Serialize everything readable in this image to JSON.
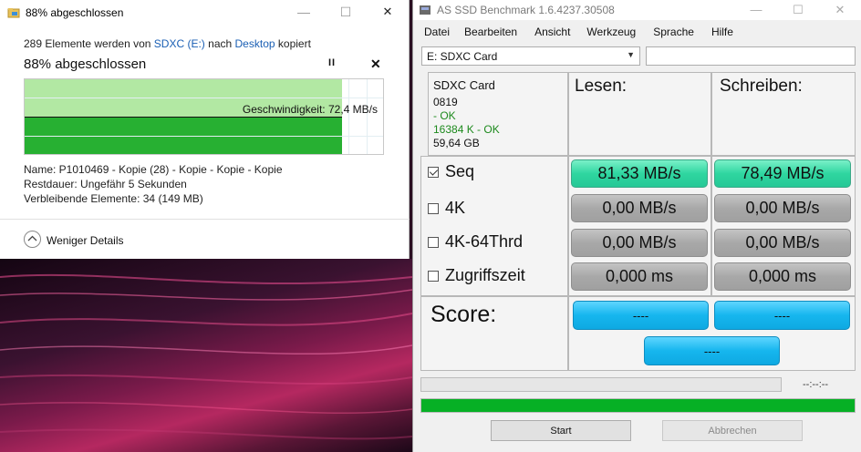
{
  "copy_dialog": {
    "title": "88% abgeschlossen",
    "summary_prefix": "289 Elemente werden von",
    "source": "SDXC (E:)",
    "summary_middle": "nach",
    "destination": "Desktop",
    "summary_suffix": "kopiert",
    "percent_text": "88% abgeschlossen",
    "progress_fraction": 0.88,
    "speed_label": "Geschwindigkeit: 72,4 MB/s",
    "name_line": "Name:  P1010469 - Kopie (28) - Kopie - Kopie - Kopie",
    "remaining_line": "Restdauer:  Ungefähr 5 Sekunden",
    "items_line": "Verbleibende Elemente:  34 (149 MB)",
    "details_label": "Weniger Details",
    "pause_symbol": "II",
    "cancel_symbol": "✕",
    "minimize_symbol": "—",
    "maximize_symbol": "☐",
    "close_symbol": "✕"
  },
  "ssd": {
    "title": "AS SSD Benchmark 1.6.4237.30508",
    "menu": [
      "Datei",
      "Bearbeiten",
      "Ansicht",
      "Werkzeug",
      "Sprache",
      "Hilfe"
    ],
    "drive_selected": "E: SDXC Card",
    "drive": {
      "name": "SDXC Card",
      "id": "0819",
      "status1": " - OK",
      "status2": "16384 K - OK",
      "size": "59,64 GB"
    },
    "col_read": "Lesen:",
    "col_write": "Schreiben:",
    "rows": [
      {
        "label": "Seq",
        "checked": true,
        "read": "81,33 MB/s",
        "write": "78,49 MB/s"
      },
      {
        "label": "4K",
        "checked": false,
        "read": "0,00 MB/s",
        "write": "0,00 MB/s"
      },
      {
        "label": "4K-64Thrd",
        "checked": false,
        "read": "0,00 MB/s",
        "write": "0,00 MB/s"
      },
      {
        "label": "Zugriffszeit",
        "checked": false,
        "read": "0,000 ms",
        "write": "0,000 ms"
      }
    ],
    "score_label": "Score:",
    "score_read": "----",
    "score_write": "----",
    "score_total": "----",
    "time_text": "--:--:--",
    "overall_progress_fraction": 1.0,
    "start_label": "Start",
    "abort_label": "Abbrechen",
    "minimize_symbol": "—",
    "maximize_symbol": "☐",
    "close_symbol": "✕"
  }
}
